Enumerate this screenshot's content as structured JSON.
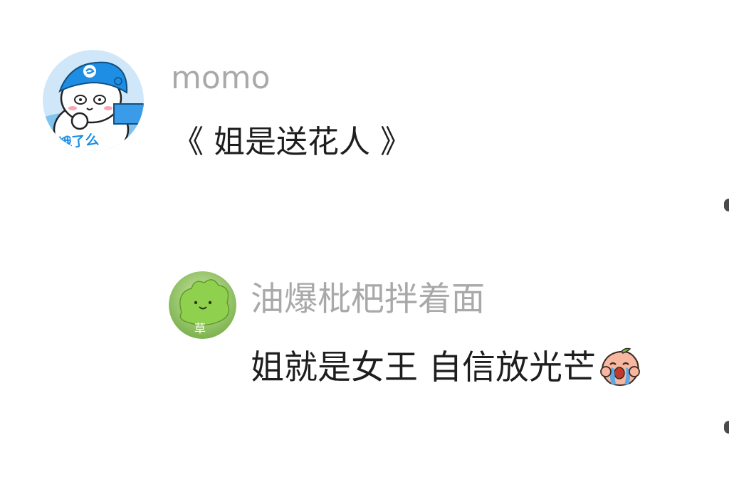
{
  "comments": [
    {
      "username": "momo",
      "text": "《 姐是送花人 》",
      "avatar": {
        "description": "cartoon-cat-avatar",
        "badge_text": "饿了么",
        "bg_color": "#7fc3ee",
        "accent_color": "#1e8ee5"
      }
    },
    {
      "username": "油爆枇杷拌着面",
      "text": "姐就是女王 自信放光芒",
      "emoji": "crying-peach-emoji",
      "avatar": {
        "description": "green-cabbage-avatar",
        "badge_text": "草",
        "bg_color": "#8bc34a"
      }
    }
  ]
}
